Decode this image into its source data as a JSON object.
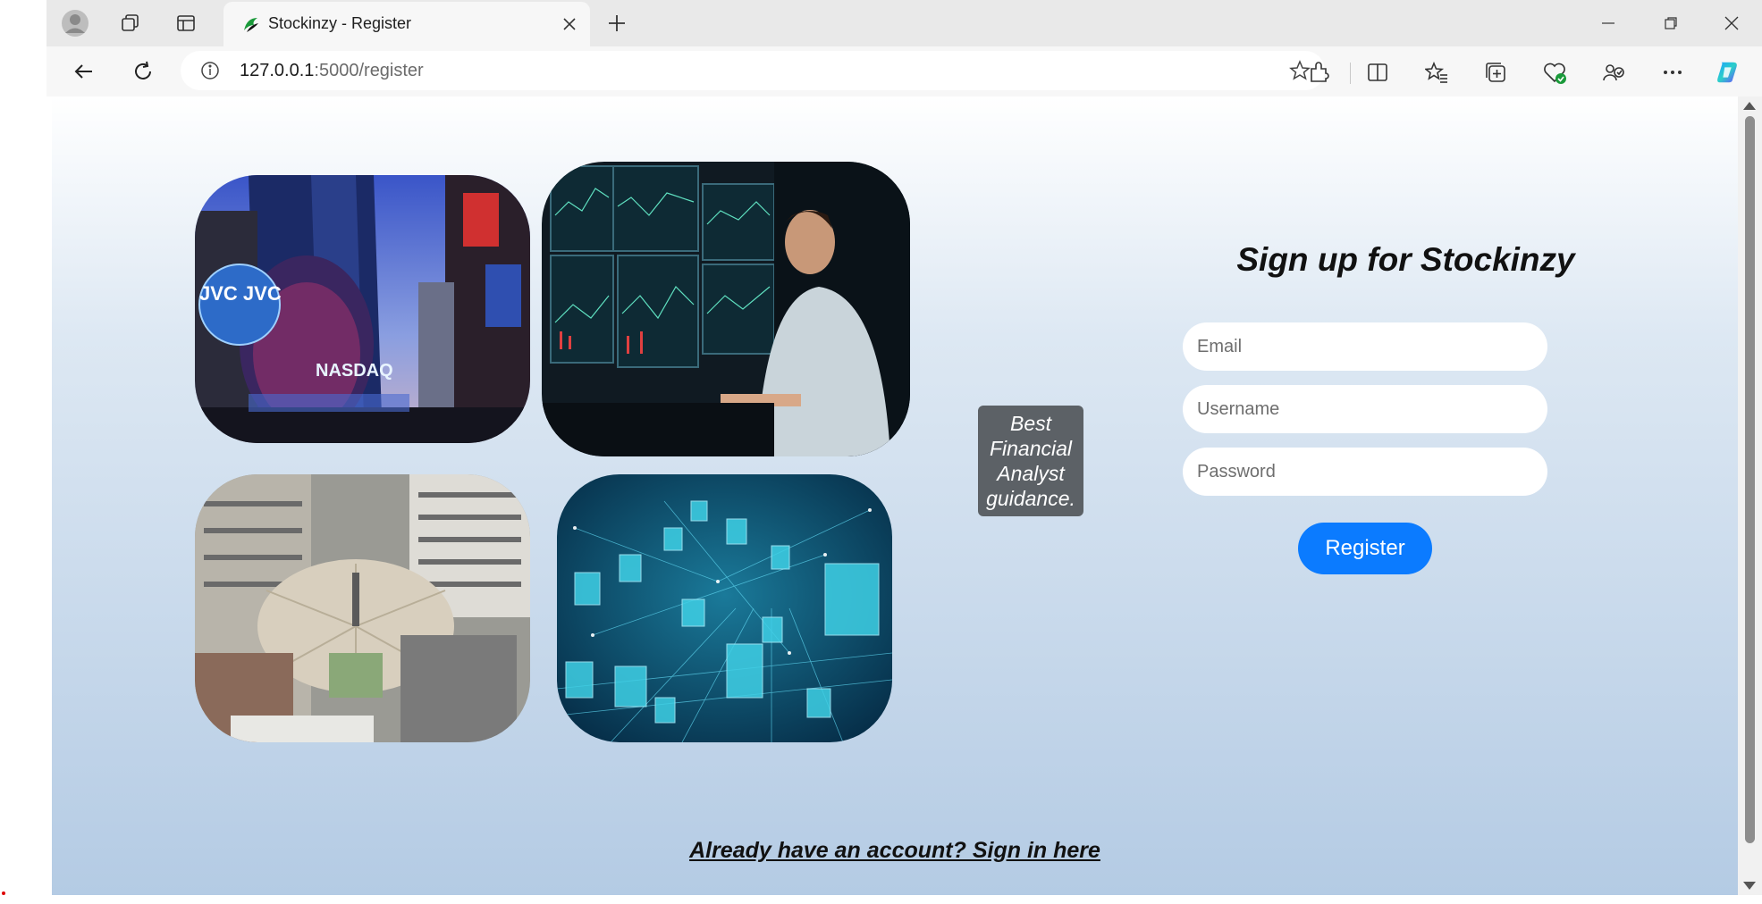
{
  "browser": {
    "tab_title": "Stockinzy - Register",
    "url_host": "127.0.0.1",
    "url_path": ":5000/register"
  },
  "page": {
    "badge_text": "Best Financial Analyst guidance.",
    "form_title": "Sign up for Stockinzy",
    "email_placeholder": "Email",
    "username_placeholder": "Username",
    "password_placeholder": "Password",
    "register_label": "Register",
    "signin_link": "Already have an account? Sign in here"
  },
  "images": [
    {
      "name": "nasdaq-building-photo",
      "icon": "nasdaq-photo"
    },
    {
      "name": "trader-monitors-photo",
      "icon": "trader-photo"
    },
    {
      "name": "city-plaza-photo",
      "icon": "plaza-photo"
    },
    {
      "name": "blockchain-cubes-photo",
      "icon": "cubes-photo"
    }
  ],
  "colors": {
    "accent": "#0b7bff",
    "badge": "#5c6166"
  }
}
